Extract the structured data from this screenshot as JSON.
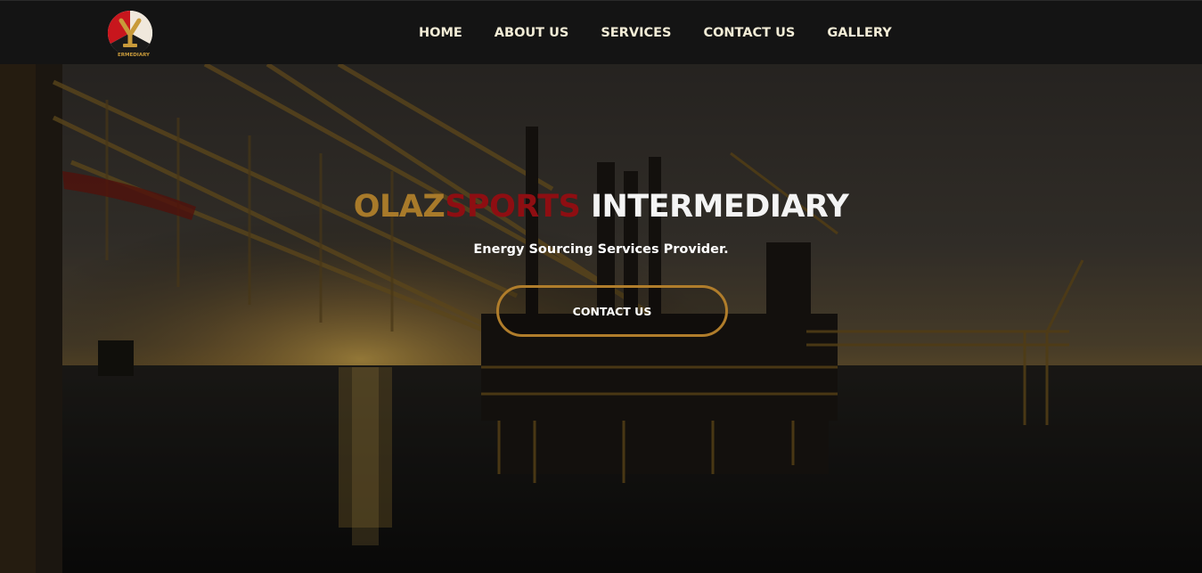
{
  "brand": {
    "logo_alt": "Olazsports Intermediary logo",
    "logo_text_top": "OLAZSPORTS",
    "logo_text_bottom": "ERMEDIARY",
    "colors": {
      "gold": "#a87a2a",
      "red": "#8e0e12",
      "nav_bg": "#141414"
    }
  },
  "nav": {
    "items": [
      {
        "label": "HOME"
      },
      {
        "label": "ABOUT US"
      },
      {
        "label": "SERVICES"
      },
      {
        "label": "CONTACT US"
      },
      {
        "label": "GALLERY"
      }
    ]
  },
  "hero": {
    "title_part1": "OLAZ",
    "title_part2": "SPORTS",
    "title_part3": " INTERMEDIARY",
    "subtitle": "Energy Sourcing Services Provider.",
    "cta_label": "CONTACT US",
    "background": "offshore oil platform at sunset"
  }
}
